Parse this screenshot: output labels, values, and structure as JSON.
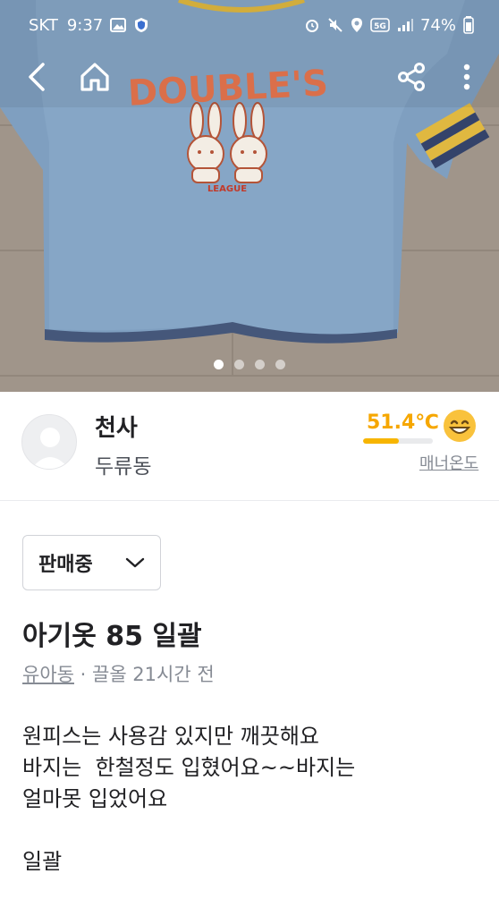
{
  "status_bar": {
    "carrier": "SKT",
    "time": "9:37",
    "network": "5G",
    "battery": "74%"
  },
  "product_image": {
    "sweater_text": "DOUBLE'S",
    "sweater_subtext": "LEAGUE",
    "page_count": 4,
    "active_page": 1
  },
  "seller": {
    "name": "천사",
    "location": "두류동",
    "temperature": "51.4℃",
    "temperature_fraction": 0.514,
    "manner_label": "매너온도"
  },
  "product": {
    "status_label": "판매중",
    "title": "아기옷 85 일괄",
    "category": "유아동",
    "meta_suffix": " · 끌올 21시간 전",
    "description": [
      "원피스는 사용감 있지만 깨끗해요",
      "바지는  한철정도 입혔어요~~바지는",
      "얼마못 입었어요",
      "",
      "일괄"
    ]
  },
  "colors": {
    "temperature": "#f6a700",
    "text_primary": "#212124",
    "text_secondary": "#868b94"
  }
}
